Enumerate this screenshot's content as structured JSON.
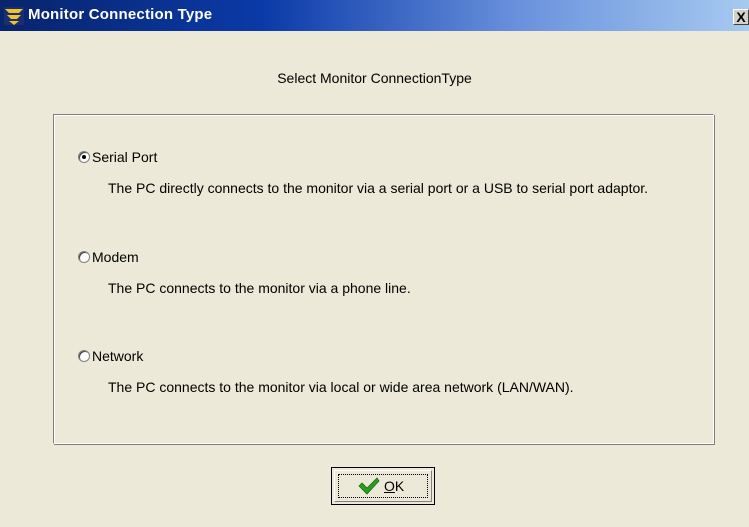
{
  "window": {
    "title": "Monitor Connection Type",
    "close_glyph": "X"
  },
  "heading": "Select Monitor ConnectionType",
  "options": [
    {
      "label": "Serial Port",
      "description": "The PC directly connects to the monitor via a serial port or a USB to serial port adaptor.",
      "checked": true
    },
    {
      "label": "Modem",
      "description": "The PC connects to the monitor via a phone line.",
      "checked": false
    },
    {
      "label": "Network",
      "description": "The PC connects to the monitor via local or wide area network (LAN/WAN).",
      "checked": false
    }
  ],
  "ok_button": {
    "mnemonic": "O",
    "rest": "K"
  },
  "colors": {
    "dialog_bg": "#ece9d8",
    "titlebar_start": "#08246b",
    "titlebar_end": "#a6caf0",
    "check_green": "#2a9d1f"
  }
}
